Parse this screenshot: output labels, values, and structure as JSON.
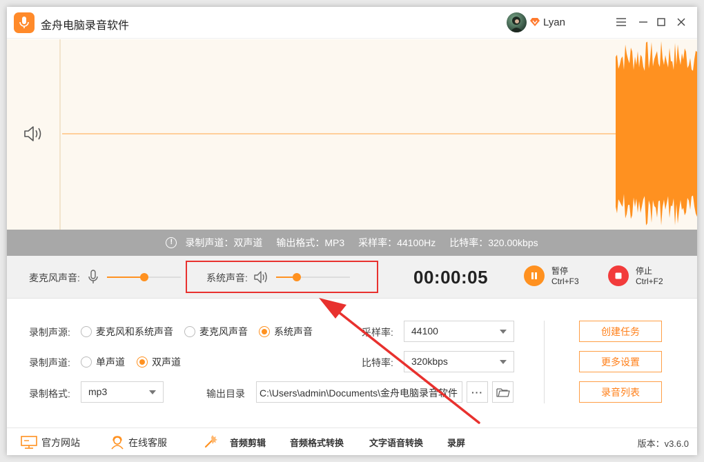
{
  "app": {
    "title": "金舟电脑录音软件",
    "username": "Lyan"
  },
  "info": {
    "channel": "录制声道：双声道",
    "format": "输出格式：MP3",
    "sample": "采样率：44100Hz",
    "bitrate": "比特率：320.00kbps"
  },
  "controls": {
    "mic_label": "麦克风声音:",
    "mic_volume": 0.5,
    "system_label": "系统声音:",
    "system_volume": 0.28,
    "timer": "00:00:05",
    "pause_label": "暂停",
    "pause_shortcut": "Ctrl+F3",
    "stop_label": "停止",
    "stop_shortcut": "Ctrl+F2"
  },
  "settings": {
    "source_label": "录制声源:",
    "source_options": [
      "麦克风和系统声音",
      "麦克风声音",
      "系统声音"
    ],
    "source_selected": "系统声音",
    "channel_label": "录制声道:",
    "channel_options": [
      "单声道",
      "双声道"
    ],
    "channel_selected": "双声道",
    "format_label": "录制格式:",
    "format_value": "mp3",
    "sample_label": "采样率:",
    "sample_value": "44100",
    "bitrate_label": "比特率:",
    "bitrate_value": "320kbps",
    "output_label": "输出目录",
    "output_path": "C:\\Users\\admin\\Documents\\金舟电脑录音软件",
    "more_label": "···"
  },
  "actions": {
    "create": "创建任务",
    "more": "更多设置",
    "list": "录音列表"
  },
  "footer": {
    "website": "官方网站",
    "service": "在线客服",
    "audio_edit": "音频剪辑",
    "format_convert": "音频格式转换",
    "tts": "文字语音转换",
    "screen_record": "录屏",
    "version": "版本：v3.6.0"
  },
  "colors": {
    "accent": "#ff9120",
    "stop": "#f23b3b",
    "annotation": "#e8312e"
  }
}
